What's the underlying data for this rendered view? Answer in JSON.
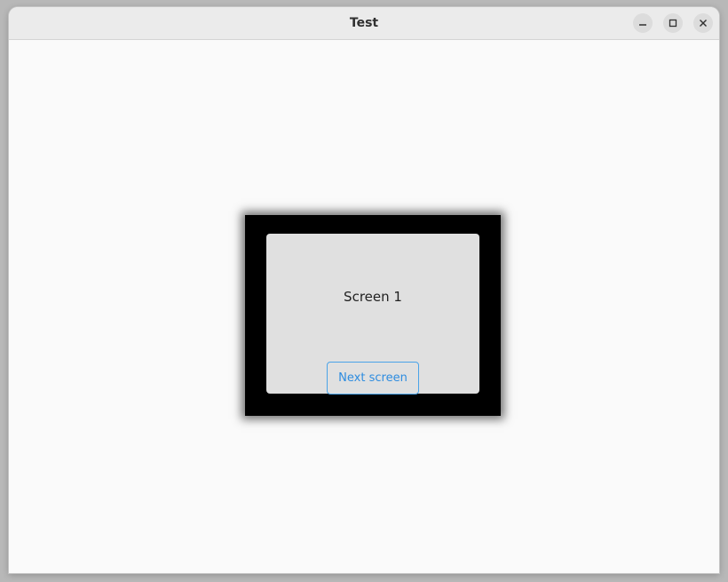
{
  "window": {
    "title": "Test",
    "controls": {
      "minimize": "minimize-icon",
      "maximize": "maximize-icon",
      "close": "close-icon"
    }
  },
  "screen": {
    "label": "Screen 1",
    "next_button_label": "Next screen"
  },
  "colors": {
    "accent": "#2d8ce0",
    "frame": "#000000",
    "screen_bg": "#e0e0e0",
    "window_bg": "#fafafa"
  }
}
